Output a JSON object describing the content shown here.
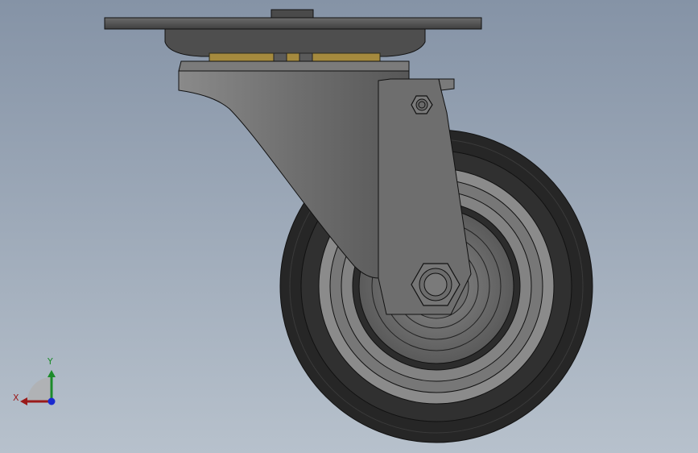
{
  "model": {
    "name": "caster-wheel-assembly",
    "parts": [
      "top-plate",
      "swivel-bearing",
      "fork-bracket",
      "fork-arm",
      "bolt-head-small",
      "axle-nut",
      "wheel-tire",
      "wheel-hub"
    ]
  },
  "triad": {
    "x_label": "X",
    "y_label": "Y"
  },
  "colors": {
    "background_top": "#8593a6",
    "background_bottom": "#b7c1cc",
    "steel": "#6a6a6a",
    "plate": "#5b5b5b",
    "bearing_ring": "#a58a3e",
    "tire": "#2a2a2a",
    "hub": "#7c7c7c",
    "axis_x": "#9a1a1a",
    "axis_y": "#1c8b2a",
    "axis_z": "#1a2ad0"
  }
}
